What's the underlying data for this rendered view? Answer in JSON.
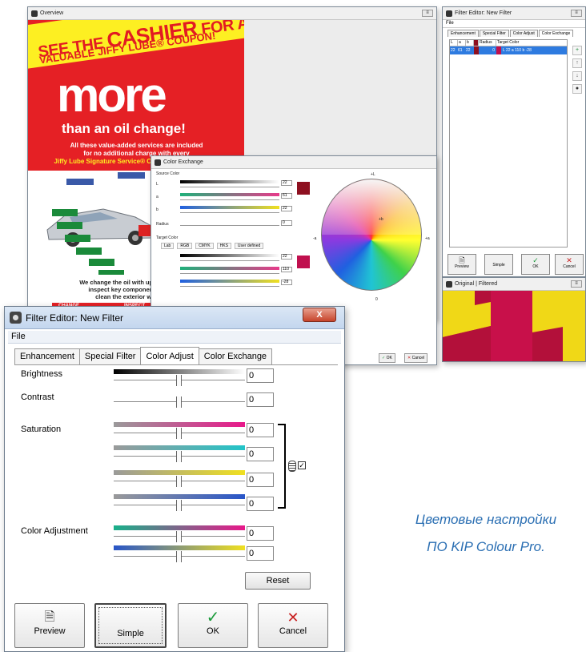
{
  "overview": {
    "title": "Overview",
    "ad": {
      "line1_prefix": "SEE THE",
      "line1_highlight": "CASHIER",
      "line1_suffix": "FOR A",
      "line2": "VALUABLE JIFFY LUBE® COUPON!",
      "headline": "more",
      "subhead": "than an oil change!",
      "body_line1": "All these value-added services are included",
      "body_line2": "for no additional charge with every",
      "body_line3": "Jiffy Lube Signature Service® Oil Change we perform:",
      "bottom_line1": "We change the oil with up to five quarts of qu",
      "bottom_line2": "inspect key components, check and fill",
      "bottom_line3": "clean the exterior windows and va",
      "table_col1": "CHANGE",
      "table_col2": "INSPECT"
    }
  },
  "filter_small": {
    "title": "Filter Editor: New Filter",
    "menu_file": "File",
    "tabs": [
      "Enhancement",
      "Special Filter",
      "Color Adjust",
      "Color Exchange"
    ],
    "list_headers": [
      "L",
      "a",
      "b",
      "Radius",
      "Target Color"
    ],
    "list_row": [
      "22",
      "61",
      "22",
      "0",
      "L 22 a 110 b -28"
    ],
    "buttons": [
      "Preview",
      "Simple",
      "OK",
      "Cancel"
    ]
  },
  "original_window": {
    "title": "Original | Filtered"
  },
  "color_exchange": {
    "title": "Color Exchange",
    "source_label": "Source Color",
    "l_label": "L",
    "a_label": "a",
    "b_label": "b",
    "radius_label": "Radius",
    "target_label": "Target Color",
    "tabs": [
      "Lab",
      "RGB",
      "CMYK",
      "HKS",
      "User defined"
    ],
    "source_values": [
      "22",
      "61",
      "22",
      "0"
    ],
    "target_values": [
      "22",
      "110",
      "-28"
    ],
    "source_swatch": "#8e1020",
    "target_swatch": "#c0104e",
    "ok": "OK",
    "cancel": "Cancel",
    "axis_plus_l": "+L",
    "axis_minus_a": "-a",
    "axis_plus_a": "+a",
    "axis_zero": "0",
    "axis_plus_b": "+b"
  },
  "filter_editor": {
    "title": "Filter Editor: New Filter",
    "close_label": "X",
    "menu_file": "File",
    "tabs": [
      "Enhancement",
      "Special Filter",
      "Color Adjust",
      "Color Exchange"
    ],
    "active_tab": "Color Adjust",
    "brightness": {
      "label": "Brightness",
      "value": "0"
    },
    "contrast": {
      "label": "Contrast",
      "value": "0"
    },
    "saturation": {
      "label": "Saturation",
      "values": [
        "0",
        "0",
        "0",
        "0"
      ]
    },
    "color_adjustment": {
      "label": "Color Adjustment",
      "values": [
        "0",
        "0"
      ]
    },
    "reset": "Reset",
    "buttons": {
      "preview": "Preview",
      "simple": "Simple",
      "ok": "OK",
      "cancel": "Cancel"
    }
  },
  "caption": {
    "line1": "Цветовые настройки",
    "line2": "ПО KIP Colour Pro."
  },
  "colors": {
    "accent_blue": "#2b6fb3",
    "ad_red": "#e52025",
    "ad_yellow": "#fdef22",
    "ok_green": "#1a9a3a",
    "cancel_red": "#c81e1e",
    "filtered_crimson": "#b3103a",
    "filtered_yellow": "#f0d817"
  }
}
